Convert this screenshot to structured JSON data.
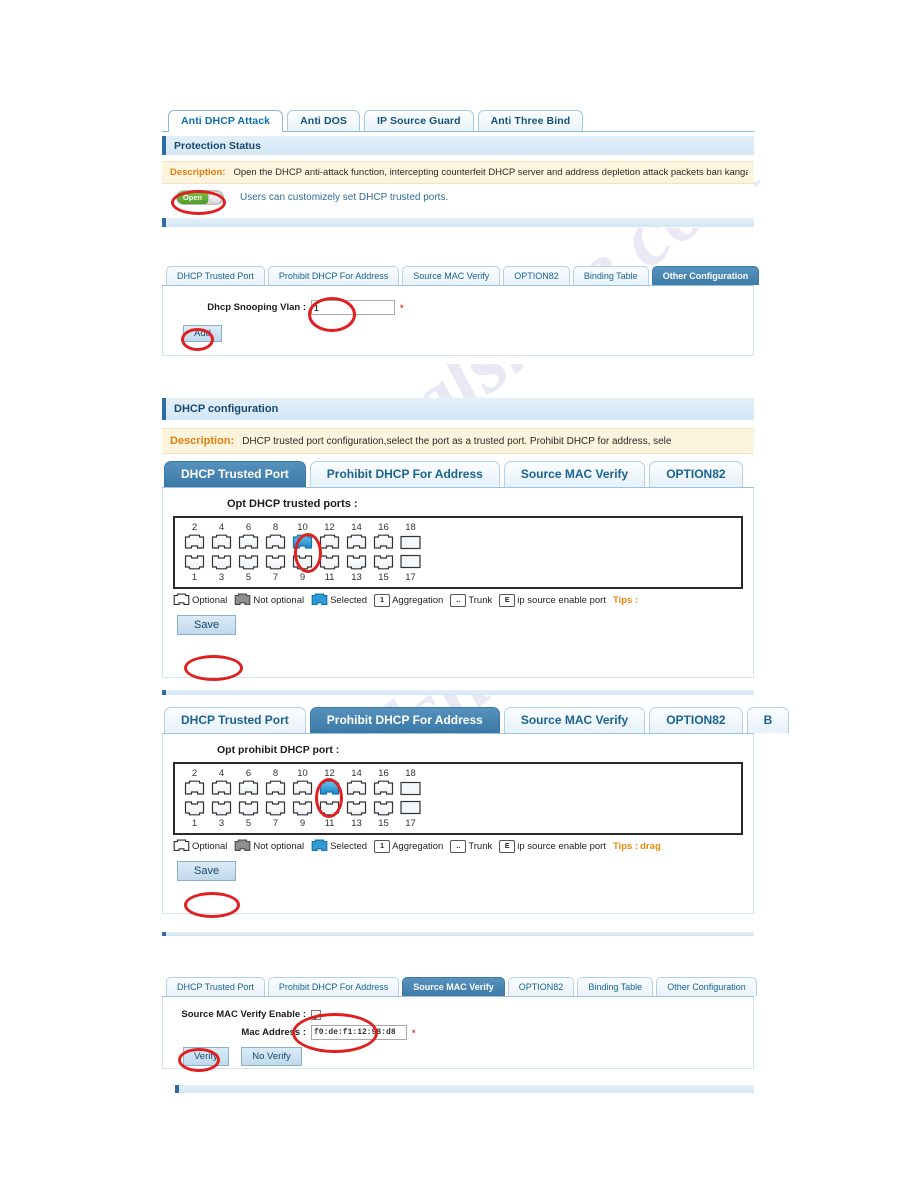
{
  "watermark": {
    "line1": "ualshive.com",
    "line2": "manualshive"
  },
  "top_tabs": [
    {
      "label": "Anti DHCP Attack",
      "active": true
    },
    {
      "label": "Anti DOS",
      "active": false
    },
    {
      "label": "IP Source Guard",
      "active": false
    },
    {
      "label": "Anti Three Bind",
      "active": false
    }
  ],
  "protection_status": {
    "section_title": "Protection Status",
    "description_label": "Description:",
    "description_text": "Open the DHCP anti-attack function, intercepting counterfeit DHCP server and address depletion attack packets ban kangaroo DHCP se",
    "toggle": {
      "state_label": "Open",
      "enabled": true
    },
    "toggle_hint": "Users can customizely set DHCP trusted ports."
  },
  "snooping_tabs": [
    {
      "label": "DHCP Trusted Port",
      "active": false
    },
    {
      "label": "Prohibit DHCP For Address",
      "active": false
    },
    {
      "label": "Source MAC Verify",
      "active": false
    },
    {
      "label": "OPTION82",
      "active": false
    },
    {
      "label": "Binding Table",
      "active": false
    },
    {
      "label": "Other Configuration",
      "active": true
    }
  ],
  "other_configuration": {
    "vlan_label": "Dhcp Snooping Vlan :",
    "vlan_value": "1",
    "required_mark": "*",
    "add_button": "Add"
  },
  "dhcp_configuration": {
    "section_title": "DHCP configuration",
    "description_label": "Description:",
    "description_text": "DHCP trusted port configuration,select the port as a trusted port. Prohibit DHCP for address, sele"
  },
  "config_tabs_1": [
    {
      "label": "DHCP Trusted Port",
      "active": true
    },
    {
      "label": "Prohibit DHCP For Address",
      "active": false
    },
    {
      "label": "Source MAC Verify",
      "active": false
    },
    {
      "label": "OPTION82",
      "active": false
    }
  ],
  "trusted_ports_panel": {
    "title": "Opt DHCP trusted ports :",
    "top_labels": [
      "2",
      "4",
      "6",
      "8",
      "10",
      "12",
      "14",
      "16",
      "18"
    ],
    "bottom_labels": [
      "1",
      "3",
      "5",
      "7",
      "9",
      "11",
      "13",
      "15",
      "17"
    ],
    "top_states": [
      "optional",
      "optional",
      "optional",
      "optional",
      "selected",
      "optional",
      "optional",
      "optional",
      "sfp"
    ],
    "bottom_states": [
      "optional",
      "optional",
      "optional",
      "optional",
      "optional",
      "optional",
      "optional",
      "optional",
      "sfp"
    ],
    "selected_port": "10",
    "save_button": "Save"
  },
  "legend": {
    "optional": "Optional",
    "not_optional": "Not optional",
    "selected": "Selected",
    "aggregation": "Aggregation",
    "aggregation_mark": "1",
    "trunk": "Trunk",
    "trunk_mark": "..",
    "ip_source": "ip source enable port",
    "ip_source_mark": "E",
    "tips_label": "Tips :",
    "tips_text_short": "",
    "tips_text_long": "drag"
  },
  "config_tabs_2": [
    {
      "label": "DHCP Trusted Port",
      "active": false
    },
    {
      "label": "Prohibit DHCP For Address",
      "active": true
    },
    {
      "label": "Source MAC Verify",
      "active": false
    },
    {
      "label": "OPTION82",
      "active": false
    },
    {
      "label": "B",
      "active": false
    }
  ],
  "prohibit_ports_panel": {
    "title": "Opt prohibit DHCP port :",
    "top_labels": [
      "2",
      "4",
      "6",
      "8",
      "10",
      "12",
      "14",
      "16",
      "18"
    ],
    "bottom_labels": [
      "1",
      "3",
      "5",
      "7",
      "9",
      "11",
      "13",
      "15",
      "17"
    ],
    "top_states": [
      "optional",
      "optional",
      "optional",
      "optional",
      "optional",
      "selected",
      "optional",
      "optional",
      "sfp"
    ],
    "bottom_states": [
      "optional",
      "optional",
      "optional",
      "optional",
      "optional",
      "optional",
      "optional",
      "optional",
      "sfp"
    ],
    "selected_port": "12",
    "save_button": "Save"
  },
  "config_tabs_3": [
    {
      "label": "DHCP Trusted Port",
      "active": false
    },
    {
      "label": "Prohibit DHCP For Address",
      "active": false
    },
    {
      "label": "Source MAC Verify",
      "active": true
    },
    {
      "label": "OPTION82",
      "active": false
    },
    {
      "label": "Binding Table",
      "active": false
    },
    {
      "label": "Other Configuration",
      "active": false
    }
  ],
  "source_mac_verify": {
    "enable_label": "Source MAC Verify Enable :",
    "enable_checked": true,
    "mac_label": "Mac Address :",
    "mac_value": "f0:de:f1:12:98:d8",
    "required_mark": "*",
    "verify_button": "Verify",
    "no_verify_button": "No Verify"
  },
  "colors": {
    "tab_active_bg": "#3d7ba8",
    "selected_port": "#2e9ad6",
    "annotation": "#e02020",
    "description_bg": "#fdf4dd",
    "description_label": "#e07f10",
    "toggle_on": "#4d9b26"
  }
}
